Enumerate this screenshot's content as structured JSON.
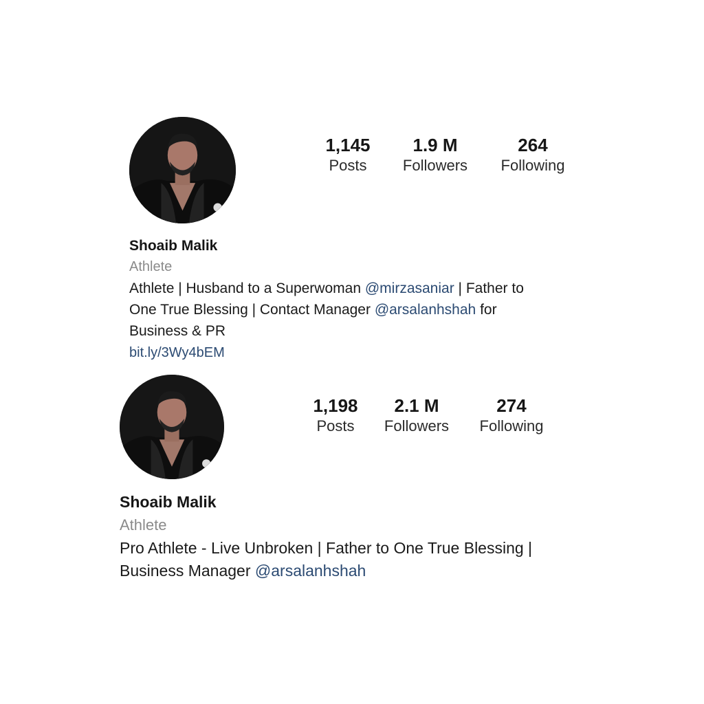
{
  "profiles": [
    {
      "stats": {
        "posts_value": "1,145",
        "posts_label": "Posts",
        "followers_value": "1.9 M",
        "followers_label": "Followers",
        "following_value": "264",
        "following_label": "Following"
      },
      "name": "Shoaib Malik",
      "category": "Athlete",
      "bio": {
        "line1_text": "Athlete | Husband to a Superwoman ",
        "line1_mention": "@mirzasaniar",
        "line1_tail": " | Father to",
        "line2_text": "One True Blessing | Contact Manager ",
        "line2_mention": "@arsalanhshah",
        "line2_tail": " for",
        "line3_text": "Business & PR"
      },
      "link": "bit.ly/3Wy4bEM"
    },
    {
      "stats": {
        "posts_value": "1,198",
        "posts_label": "Posts",
        "followers_value": "2.1 M",
        "followers_label": "Followers",
        "following_value": "274",
        "following_label": "Following"
      },
      "name": "Shoaib Malik",
      "category": "Athlete",
      "bio": {
        "line1_text": "Pro Athlete - Live Unbroken | Father to One True Blessing |",
        "line2_text": "Business Manager ",
        "line2_mention": "@arsalanhshah"
      }
    }
  ],
  "colors": {
    "mention": "#2b4a72",
    "category": "#8a8a8a",
    "avatar_bg": "#141414"
  }
}
